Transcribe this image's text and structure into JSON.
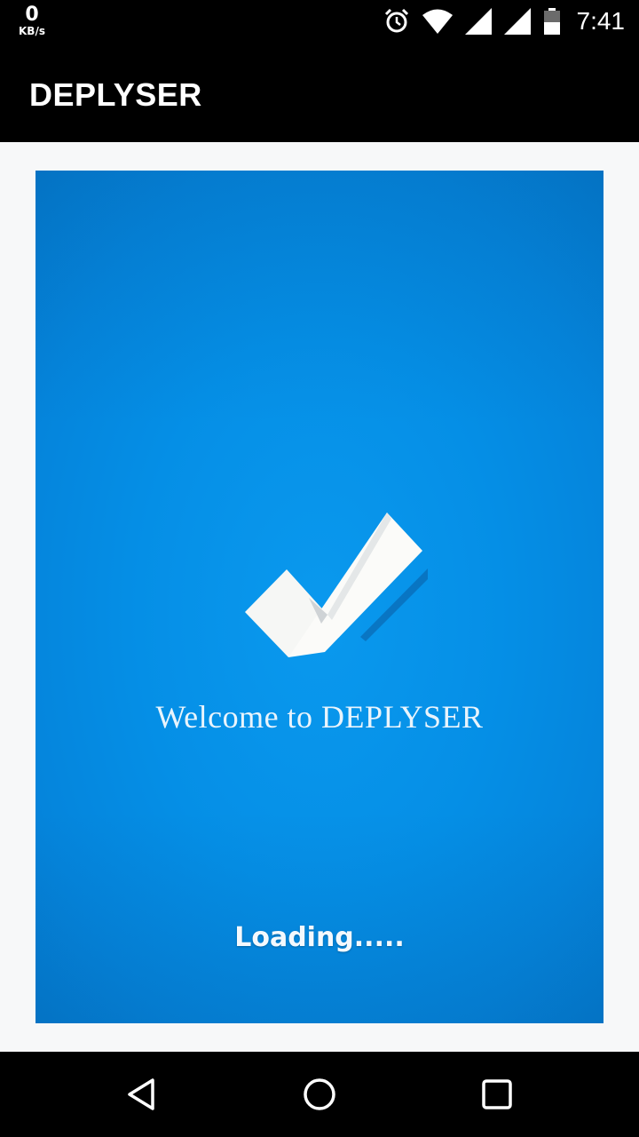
{
  "status_bar": {
    "net_speed_value": "0",
    "net_speed_unit": "KB/s",
    "time": "7:41",
    "icons": [
      "alarm-icon",
      "wifi-icon",
      "signal-icon",
      "signal-icon",
      "battery-icon"
    ]
  },
  "app_bar": {
    "title": "DEPLYSER"
  },
  "splash": {
    "welcome_text": "Welcome to DEPLYSER",
    "loading_text": "Loading.....",
    "background_color": "#0590e6",
    "logo_icon": "checkmark-icon"
  },
  "nav_bar": {
    "icons": [
      "back-icon",
      "home-icon",
      "recents-icon"
    ]
  }
}
